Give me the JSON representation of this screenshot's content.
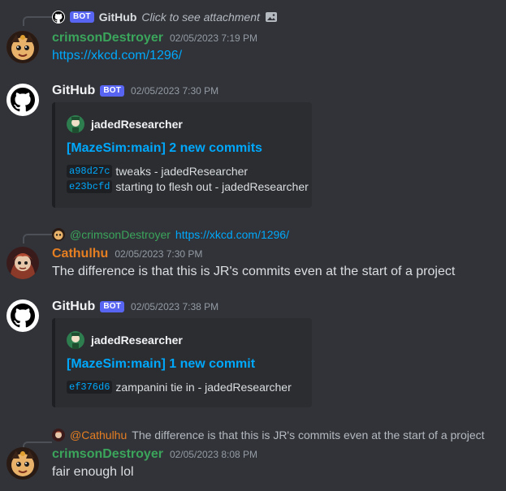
{
  "reply1": {
    "bot": "BOT",
    "author": "GitHub",
    "text": "Click to see attachment"
  },
  "msg1": {
    "author": "crimsonDestroyer",
    "author_color": "#3ba55c",
    "time": "02/05/2023 7:19 PM",
    "text": "https://xkcd.com/1296/"
  },
  "msg2": {
    "author": "GitHub",
    "bot": "BOT",
    "time": "02/05/2023 7:30 PM",
    "embed": {
      "author": "jadedResearcher",
      "title": "[MazeSim:main] 2 new commits",
      "commits": [
        {
          "hash": "a98d27c",
          "text": "tweaks - jadedResearcher"
        },
        {
          "hash": "e23bcfd",
          "text": "starting to flesh out - jadedResearcher"
        }
      ]
    }
  },
  "reply3": {
    "mention": "@crimsonDestroyer",
    "text": "https://xkcd.com/1296/"
  },
  "msg3": {
    "author": "Cathulhu",
    "author_color": "#e67e22",
    "time": "02/05/2023 7:30 PM",
    "text": "The difference is that this is JR's commits even at the start of a project"
  },
  "msg4": {
    "author": "GitHub",
    "bot": "BOT",
    "time": "02/05/2023 7:38 PM",
    "embed": {
      "author": "jadedResearcher",
      "title": "[MazeSim:main] 1 new commit",
      "commits": [
        {
          "hash": "ef376d6",
          "text": "zampanini tie in - jadedResearcher"
        }
      ]
    }
  },
  "reply5": {
    "mention": "@Cathulhu",
    "text": "The difference is that this is JR's commits even at the start of a project"
  },
  "msg5": {
    "author": "crimsonDestroyer",
    "author_color": "#3ba55c",
    "time": "02/05/2023 8:08 PM",
    "text": "fair enough lol"
  }
}
